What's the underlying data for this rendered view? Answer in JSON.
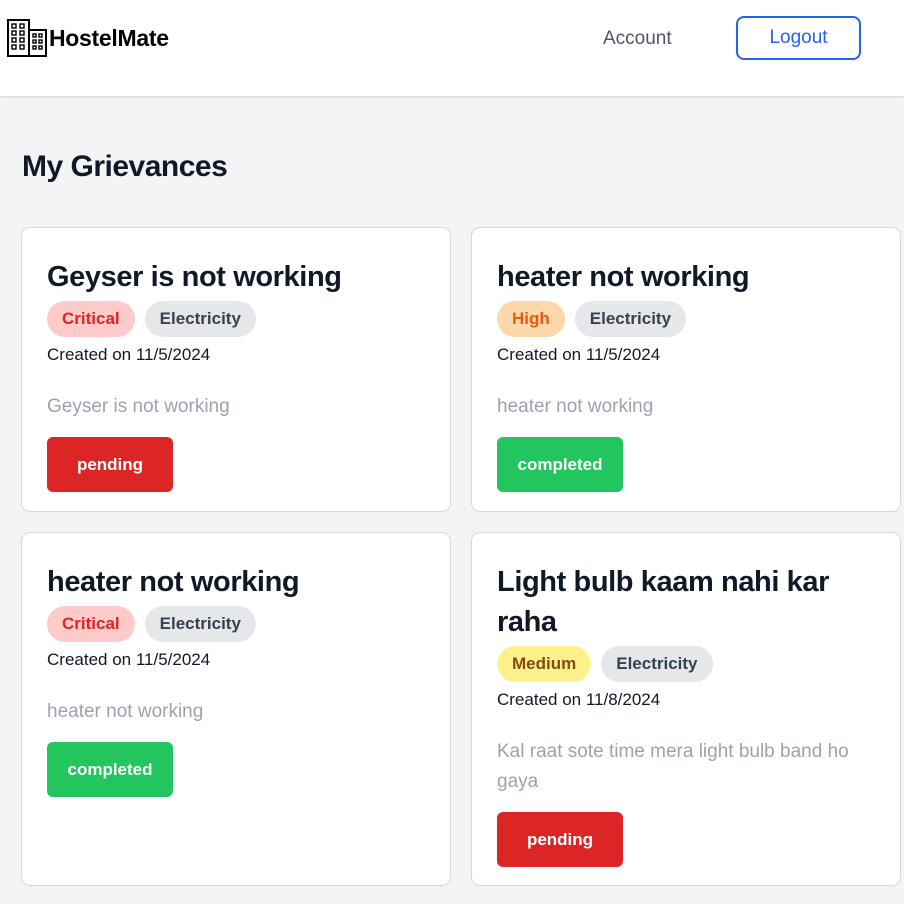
{
  "app": {
    "name": "HostelMate",
    "logo_icon": "building-icon"
  },
  "nav": {
    "account_label": "Account",
    "logout_label": "Logout"
  },
  "page": {
    "title": "My Grievances"
  },
  "colors": {
    "brand_blue": "#2563eb",
    "pending": "#dc2626",
    "completed": "#22c55e",
    "critical_bg": "#fecaca",
    "critical_fg": "#dc2626",
    "high_bg": "#fed7aa",
    "high_fg": "#ea580c",
    "medium_bg": "#fef08a",
    "medium_fg": "#854d0e"
  },
  "grievances": [
    {
      "title": "Geyser is not working",
      "priority": "Critical",
      "category": "Electricity",
      "created": "Created on 11/5/2024",
      "description": "Geyser is not working",
      "status": "pending"
    },
    {
      "title": "heater not working",
      "priority": "High",
      "category": "Electricity",
      "created": "Created on 11/5/2024",
      "description": "heater not working",
      "status": "completed"
    },
    {
      "title": "heater not working",
      "priority": "Critical",
      "category": "Electricity",
      "created": "Created on 11/5/2024",
      "description": "heater not working",
      "status": "completed"
    },
    {
      "title": "Light bulb kaam nahi kar raha",
      "priority": "Medium",
      "category": "Electricity",
      "created": "Created on 11/8/2024",
      "description": "Kal raat sote time mera light bulb band ho gaya",
      "status": "pending"
    }
  ]
}
